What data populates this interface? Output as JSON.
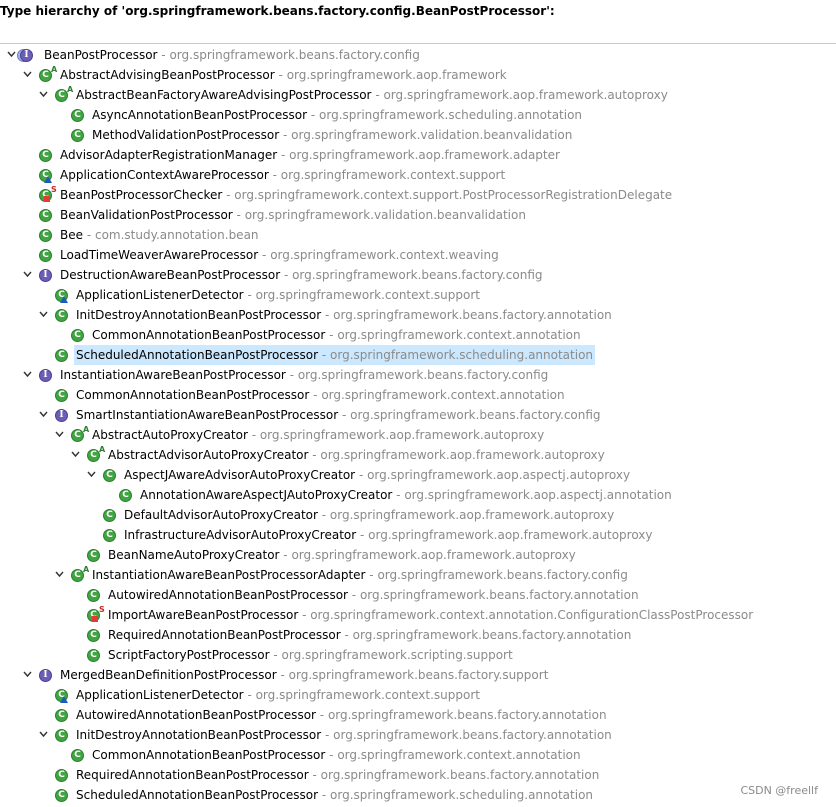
{
  "header": {
    "title": "Type hierarchy of 'org.springframework.beans.factory.config.BeanPostProcessor':"
  },
  "separator": " - ",
  "watermark": "CSDN @freellf",
  "tree": [
    {
      "name": "BeanPostProcessor",
      "pkg": "org.springframework.beans.factory.config",
      "depth": 0,
      "type": "root",
      "expander": "expanded"
    },
    {
      "name": "AbstractAdvisingBeanPostProcessor",
      "pkg": "org.springframework.aop.framework",
      "depth": 1,
      "type": "class",
      "mod": "A",
      "expander": "expanded"
    },
    {
      "name": "AbstractBeanFactoryAwareAdvisingPostProcessor",
      "pkg": "org.springframework.aop.framework.autoproxy",
      "depth": 2,
      "type": "class",
      "mod": "A",
      "expander": "expanded"
    },
    {
      "name": "AsyncAnnotationBeanPostProcessor",
      "pkg": "org.springframework.scheduling.annotation",
      "depth": 3,
      "type": "class"
    },
    {
      "name": "MethodValidationPostProcessor",
      "pkg": "org.springframework.validation.beanvalidation",
      "depth": 3,
      "type": "class"
    },
    {
      "name": "AdvisorAdapterRegistrationManager",
      "pkg": "org.springframework.aop.framework.adapter",
      "depth": 1,
      "type": "class"
    },
    {
      "name": "ApplicationContextAwareProcessor",
      "pkg": "org.springframework.context.support",
      "depth": 1,
      "type": "class",
      "overlay": "tri"
    },
    {
      "name": "BeanPostProcessorChecker",
      "pkg": "org.springframework.context.support.PostProcessorRegistrationDelegate",
      "depth": 1,
      "type": "class",
      "mod": "S",
      "overlay": "red"
    },
    {
      "name": "BeanValidationPostProcessor",
      "pkg": "org.springframework.validation.beanvalidation",
      "depth": 1,
      "type": "class"
    },
    {
      "name": "Bee",
      "pkg": "com.study.annotation.bean",
      "depth": 1,
      "type": "class"
    },
    {
      "name": "LoadTimeWeaverAwareProcessor",
      "pkg": "org.springframework.context.weaving",
      "depth": 1,
      "type": "class"
    },
    {
      "name": "DestructionAwareBeanPostProcessor",
      "pkg": "org.springframework.beans.factory.config",
      "depth": 1,
      "type": "interface",
      "expander": "expanded"
    },
    {
      "name": "ApplicationListenerDetector",
      "pkg": "org.springframework.context.support",
      "depth": 2,
      "type": "class",
      "overlay": "tri"
    },
    {
      "name": "InitDestroyAnnotationBeanPostProcessor",
      "pkg": "org.springframework.beans.factory.annotation",
      "depth": 2,
      "type": "class",
      "expander": "expanded"
    },
    {
      "name": "CommonAnnotationBeanPostProcessor",
      "pkg": "org.springframework.context.annotation",
      "depth": 3,
      "type": "class"
    },
    {
      "name": "ScheduledAnnotationBeanPostProcessor",
      "pkg": "org.springframework.scheduling.annotation",
      "depth": 2,
      "type": "class",
      "selected": true
    },
    {
      "name": "InstantiationAwareBeanPostProcessor",
      "pkg": "org.springframework.beans.factory.config",
      "depth": 1,
      "type": "interface",
      "expander": "expanded"
    },
    {
      "name": "CommonAnnotationBeanPostProcessor",
      "pkg": "org.springframework.context.annotation",
      "depth": 2,
      "type": "class"
    },
    {
      "name": "SmartInstantiationAwareBeanPostProcessor",
      "pkg": "org.springframework.beans.factory.config",
      "depth": 2,
      "type": "interface",
      "expander": "expanded"
    },
    {
      "name": "AbstractAutoProxyCreator",
      "pkg": "org.springframework.aop.framework.autoproxy",
      "depth": 3,
      "type": "class",
      "mod": "A",
      "expander": "expanded"
    },
    {
      "name": "AbstractAdvisorAutoProxyCreator",
      "pkg": "org.springframework.aop.framework.autoproxy",
      "depth": 4,
      "type": "class",
      "mod": "A",
      "expander": "expanded"
    },
    {
      "name": "AspectJAwareAdvisorAutoProxyCreator",
      "pkg": "org.springframework.aop.aspectj.autoproxy",
      "depth": 5,
      "type": "class",
      "expander": "expanded"
    },
    {
      "name": "AnnotationAwareAspectJAutoProxyCreator",
      "pkg": "org.springframework.aop.aspectj.annotation",
      "depth": 6,
      "type": "class"
    },
    {
      "name": "DefaultAdvisorAutoProxyCreator",
      "pkg": "org.springframework.aop.framework.autoproxy",
      "depth": 5,
      "type": "class"
    },
    {
      "name": "InfrastructureAdvisorAutoProxyCreator",
      "pkg": "org.springframework.aop.framework.autoproxy",
      "depth": 5,
      "type": "class"
    },
    {
      "name": "BeanNameAutoProxyCreator",
      "pkg": "org.springframework.aop.framework.autoproxy",
      "depth": 4,
      "type": "class"
    },
    {
      "name": "InstantiationAwareBeanPostProcessorAdapter",
      "pkg": "org.springframework.beans.factory.config",
      "depth": 3,
      "type": "class",
      "mod": "A",
      "expander": "expanded"
    },
    {
      "name": "AutowiredAnnotationBeanPostProcessor",
      "pkg": "org.springframework.beans.factory.annotation",
      "depth": 4,
      "type": "class"
    },
    {
      "name": "ImportAwareBeanPostProcessor",
      "pkg": "org.springframework.context.annotation.ConfigurationClassPostProcessor",
      "depth": 4,
      "type": "class",
      "mod": "S",
      "overlay": "red"
    },
    {
      "name": "RequiredAnnotationBeanPostProcessor",
      "pkg": "org.springframework.beans.factory.annotation",
      "depth": 4,
      "type": "class"
    },
    {
      "name": "ScriptFactoryPostProcessor",
      "pkg": "org.springframework.scripting.support",
      "depth": 4,
      "type": "class"
    },
    {
      "name": "MergedBeanDefinitionPostProcessor",
      "pkg": "org.springframework.beans.factory.support",
      "depth": 1,
      "type": "interface",
      "expander": "expanded"
    },
    {
      "name": "ApplicationListenerDetector",
      "pkg": "org.springframework.context.support",
      "depth": 2,
      "type": "class",
      "overlay": "tri"
    },
    {
      "name": "AutowiredAnnotationBeanPostProcessor",
      "pkg": "org.springframework.beans.factory.annotation",
      "depth": 2,
      "type": "class"
    },
    {
      "name": "InitDestroyAnnotationBeanPostProcessor",
      "pkg": "org.springframework.beans.factory.annotation",
      "depth": 2,
      "type": "class",
      "expander": "expanded"
    },
    {
      "name": "CommonAnnotationBeanPostProcessor",
      "pkg": "org.springframework.context.annotation",
      "depth": 3,
      "type": "class"
    },
    {
      "name": "RequiredAnnotationBeanPostProcessor",
      "pkg": "org.springframework.beans.factory.annotation",
      "depth": 2,
      "type": "class"
    },
    {
      "name": "ScheduledAnnotationBeanPostProcessor",
      "pkg": "org.springframework.scheduling.annotation",
      "depth": 2,
      "type": "class"
    }
  ]
}
